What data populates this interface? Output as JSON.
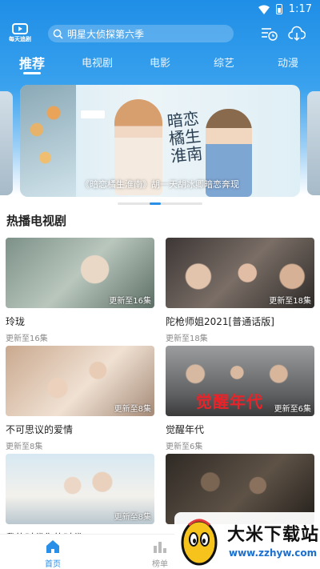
{
  "status_bar": {
    "time": "1:17",
    "icons": [
      "wifi-icon",
      "battery-icon"
    ]
  },
  "header": {
    "logo_text": "每天追剧",
    "search_placeholder": "明星大侦探第六季",
    "icons": [
      "history-icon",
      "download-icon"
    ]
  },
  "tabs": [
    {
      "label": "推荐",
      "active": true
    },
    {
      "label": "电视剧",
      "active": false
    },
    {
      "label": "电影",
      "active": false
    },
    {
      "label": "综艺",
      "active": false
    },
    {
      "label": "动漫",
      "active": false
    }
  ],
  "banner": {
    "title_art": "暗恋橘生淮南",
    "caption": "《暗恋橘生淮南》胡一天胡冰卿暗恋奔现"
  },
  "section": {
    "title": "热播电视剧"
  },
  "cards": [
    {
      "title": "玲珑",
      "update_badge": "更新至16集",
      "subtitle": "更新至16集"
    },
    {
      "title": "陀枪师姐2021[普通话版]",
      "update_badge": "更新至18集",
      "subtitle": "更新至18集"
    },
    {
      "title": "不可思议的爱情",
      "update_badge": "更新至8集",
      "subtitle": "更新至8集"
    },
    {
      "title": "觉醒年代",
      "update_badge": "更新至6集",
      "subtitle": "更新至6集",
      "poster_text": "觉醒年代"
    },
    {
      "title": "我的时代你的时代",
      "update_badge": "更新至8集",
      "subtitle": ""
    },
    {
      "title": "",
      "update_badge": "",
      "subtitle": ""
    }
  ],
  "bottom_nav": [
    {
      "label": "首页",
      "icon": "home-icon",
      "active": true
    },
    {
      "label": "榜单",
      "icon": "ranking-icon",
      "active": false
    }
  ],
  "watermark": {
    "title": "大米下载站",
    "url": "www.zzhyw.com"
  },
  "colors": {
    "accent": "#2a8fe6",
    "header_top": "#1f8ee6",
    "poster_red": "#e8242a"
  }
}
